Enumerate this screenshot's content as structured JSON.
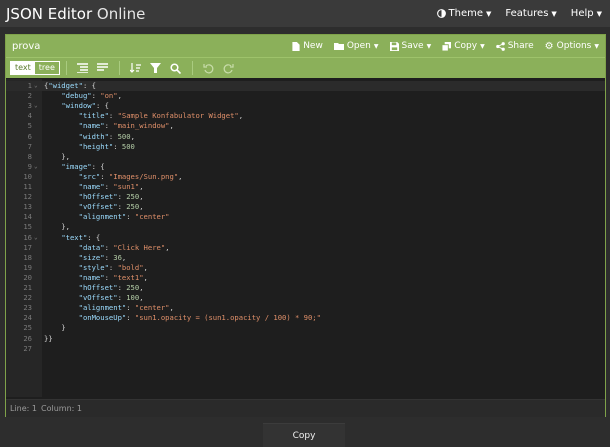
{
  "app": {
    "brand_bold": "JSON Editor",
    "brand_light": "Online",
    "menu": [
      "Theme",
      "Features",
      "Help"
    ]
  },
  "editor": {
    "doc_name": "prova",
    "actions": [
      {
        "label": "New",
        "icon": "file-icon",
        "dropdown": false
      },
      {
        "label": "Open",
        "icon": "folder-icon",
        "dropdown": true
      },
      {
        "label": "Save",
        "icon": "save-icon",
        "dropdown": true
      },
      {
        "label": "Copy",
        "icon": "copy-icon",
        "dropdown": true
      },
      {
        "label": "Share",
        "icon": "share-icon",
        "dropdown": false
      },
      {
        "label": "Options",
        "icon": "gear-icon",
        "dropdown": true
      }
    ],
    "mode_text": "text",
    "mode_tree": "tree"
  },
  "code_lines": [
    "{\"widget\": {",
    "    \"debug\": \"on\",",
    "    \"window\": {",
    "        \"title\": \"Sample Konfabulator Widget\",",
    "        \"name\": \"main_window\",",
    "        \"width\": 500,",
    "        \"height\": 500",
    "    },",
    "    \"image\": {",
    "        \"src\": \"Images/Sun.png\",",
    "        \"name\": \"sun1\",",
    "        \"hOffset\": 250,",
    "        \"vOffset\": 250,",
    "        \"alignment\": \"center\"",
    "    },",
    "    \"text\": {",
    "        \"data\": \"Click Here\",",
    "        \"size\": 36,",
    "        \"style\": \"bold\",",
    "        \"name\": \"text1\",",
    "        \"hOffset\": 250,",
    "        \"vOffset\": 100,",
    "        \"alignment\": \"center\",",
    "        \"onMouseUp\": \"sun1.opacity = (sun1.opacity / 100) * 90;\"",
    "    }",
    "}}",
    ""
  ],
  "fold_lines": [
    1,
    3,
    9,
    16
  ],
  "status": {
    "line": "Line: 1",
    "column": "Column: 1"
  },
  "copy_label": "Copy",
  "colors": {
    "accent": "#8bb05a",
    "key": "#9cdcfe",
    "string": "#e0906a",
    "number": "#b5cea8"
  }
}
